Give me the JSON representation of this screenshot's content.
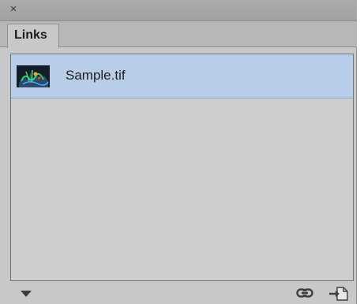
{
  "window": {
    "close_glyph": "×"
  },
  "tabs": [
    {
      "label": "Links",
      "active": true
    }
  ],
  "links_list": [
    {
      "filename": "Sample.tif",
      "selected": true,
      "thumbnail_icon": "image-thumbnail-icon"
    }
  ],
  "footer": {
    "panel_menu_icon": "triangle-down-icon",
    "link_icon": "chain-link-icon",
    "relink_icon": "relink-document-icon"
  },
  "colors": {
    "panel_bg": "#c6c8c9",
    "selection": "#b7cde8"
  }
}
